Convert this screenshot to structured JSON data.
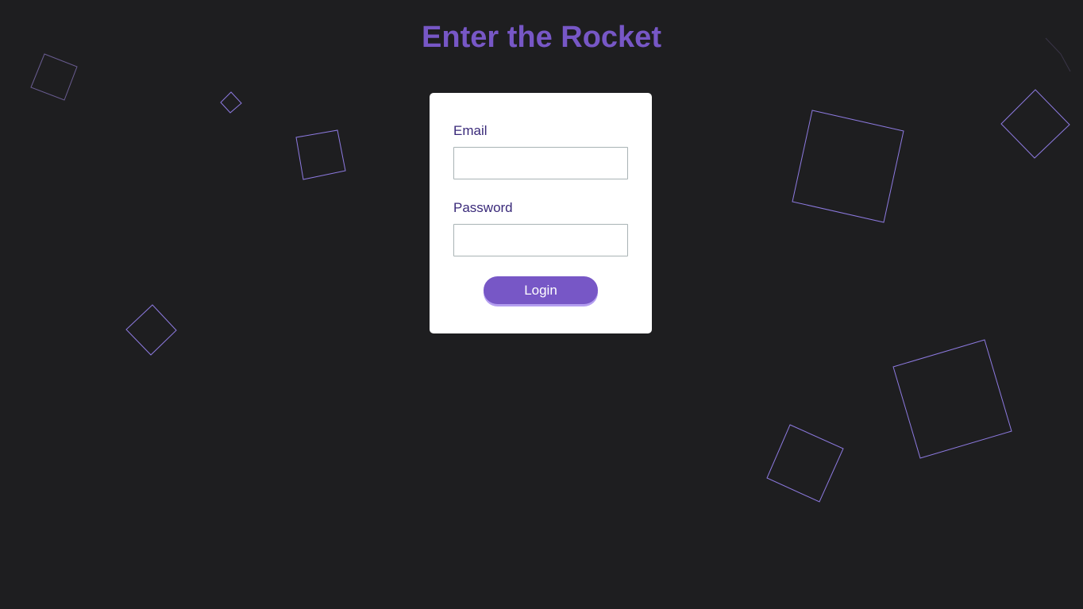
{
  "header": {
    "title": "Enter the Rocket"
  },
  "form": {
    "email_label": "Email",
    "email_value": "",
    "password_label": "Password",
    "password_value": "",
    "login_label": "Login"
  },
  "colors": {
    "background": "#1e1e20",
    "accent": "#7757c6",
    "label_text": "#3a2a7a",
    "button_shadow": "#b49ef0",
    "shape_stroke": "#8d7ae0"
  }
}
